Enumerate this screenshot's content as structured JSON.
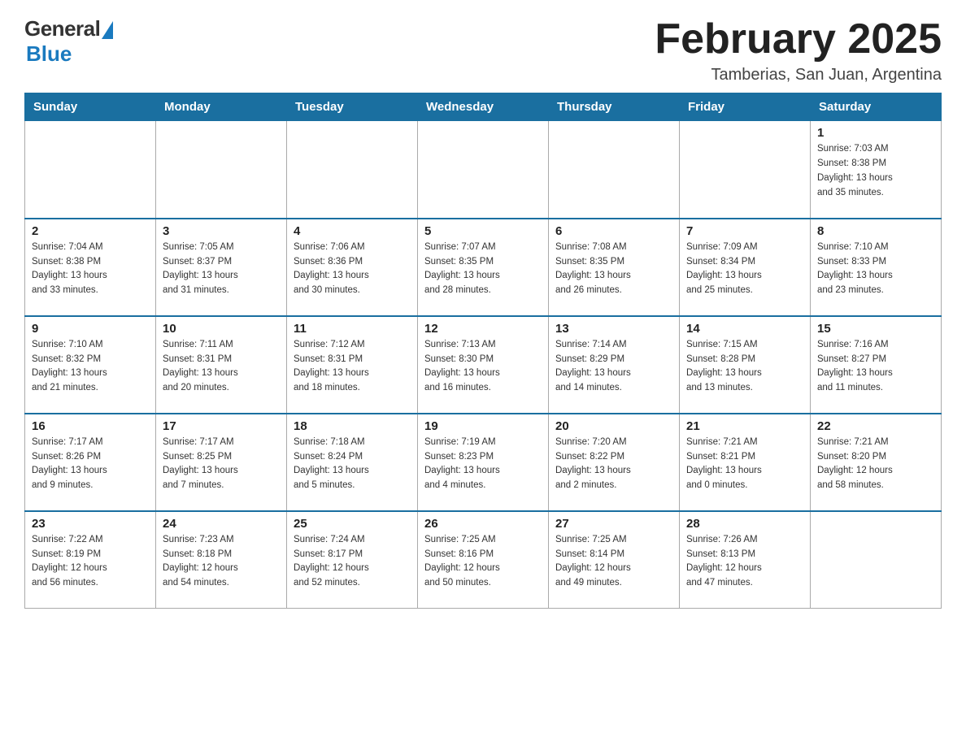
{
  "logo": {
    "general": "General",
    "blue": "Blue"
  },
  "title": "February 2025",
  "location": "Tamberias, San Juan, Argentina",
  "weekdays": [
    "Sunday",
    "Monday",
    "Tuesday",
    "Wednesday",
    "Thursday",
    "Friday",
    "Saturday"
  ],
  "weeks": [
    [
      {
        "day": "",
        "info": ""
      },
      {
        "day": "",
        "info": ""
      },
      {
        "day": "",
        "info": ""
      },
      {
        "day": "",
        "info": ""
      },
      {
        "day": "",
        "info": ""
      },
      {
        "day": "",
        "info": ""
      },
      {
        "day": "1",
        "info": "Sunrise: 7:03 AM\nSunset: 8:38 PM\nDaylight: 13 hours\nand 35 minutes."
      }
    ],
    [
      {
        "day": "2",
        "info": "Sunrise: 7:04 AM\nSunset: 8:38 PM\nDaylight: 13 hours\nand 33 minutes."
      },
      {
        "day": "3",
        "info": "Sunrise: 7:05 AM\nSunset: 8:37 PM\nDaylight: 13 hours\nand 31 minutes."
      },
      {
        "day": "4",
        "info": "Sunrise: 7:06 AM\nSunset: 8:36 PM\nDaylight: 13 hours\nand 30 minutes."
      },
      {
        "day": "5",
        "info": "Sunrise: 7:07 AM\nSunset: 8:35 PM\nDaylight: 13 hours\nand 28 minutes."
      },
      {
        "day": "6",
        "info": "Sunrise: 7:08 AM\nSunset: 8:35 PM\nDaylight: 13 hours\nand 26 minutes."
      },
      {
        "day": "7",
        "info": "Sunrise: 7:09 AM\nSunset: 8:34 PM\nDaylight: 13 hours\nand 25 minutes."
      },
      {
        "day": "8",
        "info": "Sunrise: 7:10 AM\nSunset: 8:33 PM\nDaylight: 13 hours\nand 23 minutes."
      }
    ],
    [
      {
        "day": "9",
        "info": "Sunrise: 7:10 AM\nSunset: 8:32 PM\nDaylight: 13 hours\nand 21 minutes."
      },
      {
        "day": "10",
        "info": "Sunrise: 7:11 AM\nSunset: 8:31 PM\nDaylight: 13 hours\nand 20 minutes."
      },
      {
        "day": "11",
        "info": "Sunrise: 7:12 AM\nSunset: 8:31 PM\nDaylight: 13 hours\nand 18 minutes."
      },
      {
        "day": "12",
        "info": "Sunrise: 7:13 AM\nSunset: 8:30 PM\nDaylight: 13 hours\nand 16 minutes."
      },
      {
        "day": "13",
        "info": "Sunrise: 7:14 AM\nSunset: 8:29 PM\nDaylight: 13 hours\nand 14 minutes."
      },
      {
        "day": "14",
        "info": "Sunrise: 7:15 AM\nSunset: 8:28 PM\nDaylight: 13 hours\nand 13 minutes."
      },
      {
        "day": "15",
        "info": "Sunrise: 7:16 AM\nSunset: 8:27 PM\nDaylight: 13 hours\nand 11 minutes."
      }
    ],
    [
      {
        "day": "16",
        "info": "Sunrise: 7:17 AM\nSunset: 8:26 PM\nDaylight: 13 hours\nand 9 minutes."
      },
      {
        "day": "17",
        "info": "Sunrise: 7:17 AM\nSunset: 8:25 PM\nDaylight: 13 hours\nand 7 minutes."
      },
      {
        "day": "18",
        "info": "Sunrise: 7:18 AM\nSunset: 8:24 PM\nDaylight: 13 hours\nand 5 minutes."
      },
      {
        "day": "19",
        "info": "Sunrise: 7:19 AM\nSunset: 8:23 PM\nDaylight: 13 hours\nand 4 minutes."
      },
      {
        "day": "20",
        "info": "Sunrise: 7:20 AM\nSunset: 8:22 PM\nDaylight: 13 hours\nand 2 minutes."
      },
      {
        "day": "21",
        "info": "Sunrise: 7:21 AM\nSunset: 8:21 PM\nDaylight: 13 hours\nand 0 minutes."
      },
      {
        "day": "22",
        "info": "Sunrise: 7:21 AM\nSunset: 8:20 PM\nDaylight: 12 hours\nand 58 minutes."
      }
    ],
    [
      {
        "day": "23",
        "info": "Sunrise: 7:22 AM\nSunset: 8:19 PM\nDaylight: 12 hours\nand 56 minutes."
      },
      {
        "day": "24",
        "info": "Sunrise: 7:23 AM\nSunset: 8:18 PM\nDaylight: 12 hours\nand 54 minutes."
      },
      {
        "day": "25",
        "info": "Sunrise: 7:24 AM\nSunset: 8:17 PM\nDaylight: 12 hours\nand 52 minutes."
      },
      {
        "day": "26",
        "info": "Sunrise: 7:25 AM\nSunset: 8:16 PM\nDaylight: 12 hours\nand 50 minutes."
      },
      {
        "day": "27",
        "info": "Sunrise: 7:25 AM\nSunset: 8:14 PM\nDaylight: 12 hours\nand 49 minutes."
      },
      {
        "day": "28",
        "info": "Sunrise: 7:26 AM\nSunset: 8:13 PM\nDaylight: 12 hours\nand 47 minutes."
      },
      {
        "day": "",
        "info": ""
      }
    ]
  ]
}
